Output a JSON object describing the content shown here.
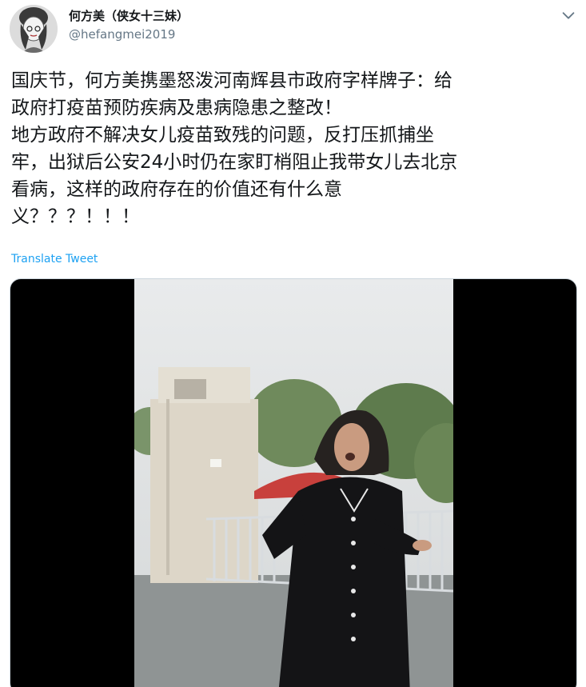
{
  "tweet": {
    "display_name": "何方美（侠女十三妹）",
    "handle": "@hefangmei2019",
    "text": "国庆节，何方美携墨怒泼河南辉县市政府字样牌子：给\n政府打疫苗预防疾病及患病隐患之整改！\n地方政府不解决女儿疫苗致残的问题，反打压抓捕坐\n牢，出狱后公安24小时仍在家盯梢阻止我带女儿去北京\n看病，这样的政府存在的价值还有什么意\n义？？？！！！",
    "translate_label": "Translate Tweet"
  },
  "icons": {
    "menu": "chevron-down-icon",
    "avatar": "avatar"
  },
  "colors": {
    "link": "#1da1f2",
    "handle": "#657786",
    "text": "#14171a"
  }
}
